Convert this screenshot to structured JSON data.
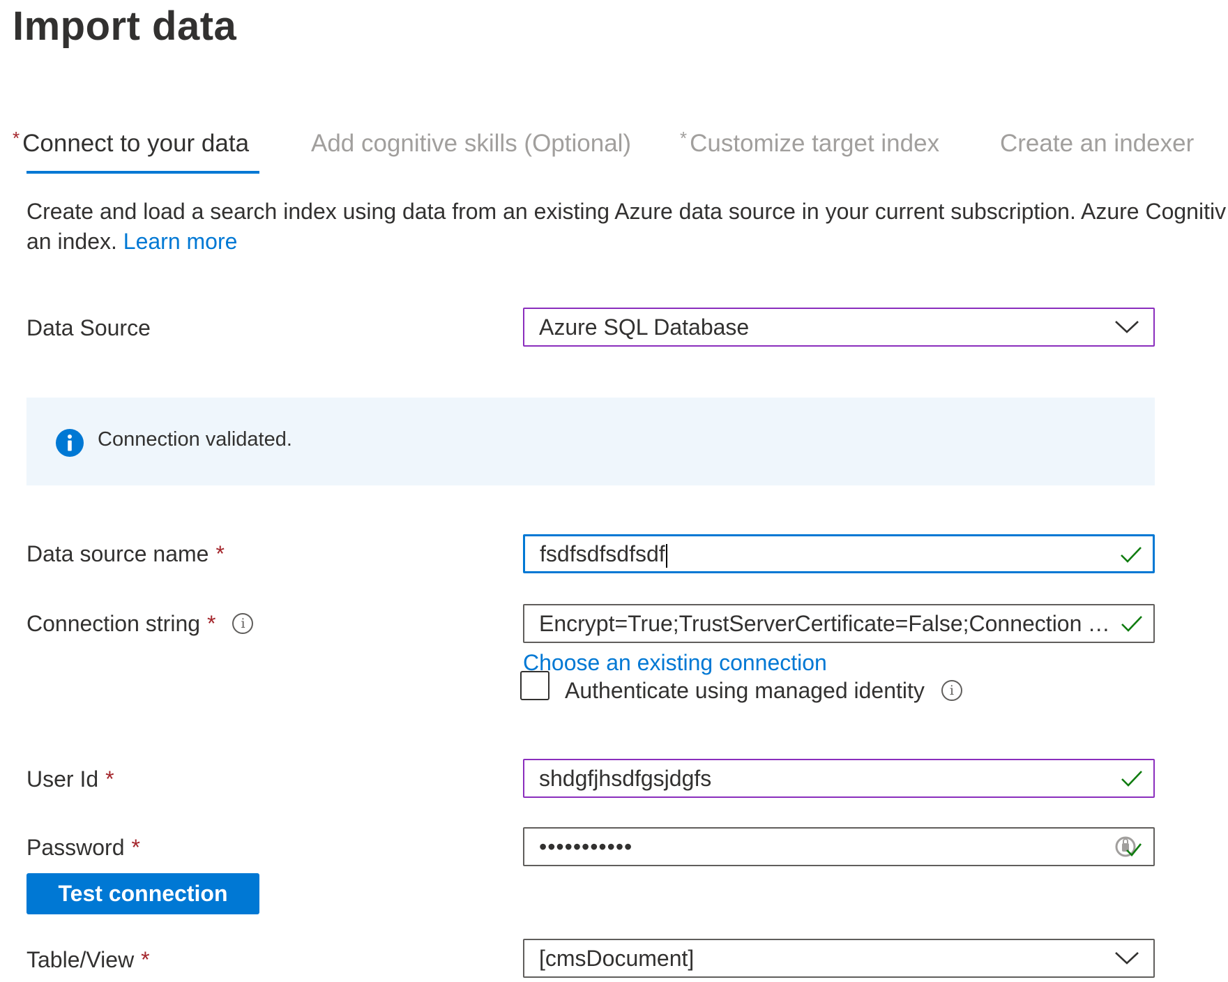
{
  "page": {
    "title": "Import data"
  },
  "tabs": [
    {
      "label": "Connect to your data",
      "required_mark": "*"
    },
    {
      "label": "Add cognitive skills (Optional)",
      "required_mark": ""
    },
    {
      "label": "Customize target index",
      "required_mark": "*"
    },
    {
      "label": "Create an indexer",
      "required_mark": ""
    }
  ],
  "intro": {
    "line1": "Create and load a search index using data from an existing Azure data source in your current subscription. Azure Cognitiv",
    "line2": "an index.",
    "learn_more": "Learn more"
  },
  "form": {
    "data_source": {
      "label": "Data Source",
      "value": "Azure SQL Database",
      "icon": "chevron-down-icon"
    },
    "banner": {
      "text": "Connection validated.",
      "icon": "info-icon",
      "color": "#0078d4"
    },
    "data_source_name": {
      "label": "Data source name",
      "required_mark": "*",
      "value": "fsdfsdfsdfsdf"
    },
    "connection_string": {
      "label": "Connection string",
      "required_mark": "*",
      "value": "Encrypt=True;TrustServerCertificate=False;Connection Ti...",
      "info_glyph": "i"
    },
    "choose_connection_link": "Choose an existing connection",
    "managed_identity": {
      "label": "Authenticate using managed identity",
      "checked": false,
      "info_glyph": "i"
    },
    "user_id": {
      "label": "User Id",
      "required_mark": "*",
      "value": "shdgfjhsdfgsjdgfs"
    },
    "password": {
      "label": "Password",
      "required_mark": "*",
      "value": "•••••••••••",
      "icon": "password-key-icon"
    },
    "test_connection_button": "Test connection",
    "table_view": {
      "label": "Table/View",
      "required_mark": "*",
      "value": "[cmsDocument]",
      "icon": "chevron-down-icon"
    }
  },
  "colors": {
    "accent": "#0078d4",
    "required": "#a4262c",
    "valid_check": "#107c10",
    "field_hover_border": "#8a2ebd",
    "banner_bg": "#eff6fc"
  }
}
